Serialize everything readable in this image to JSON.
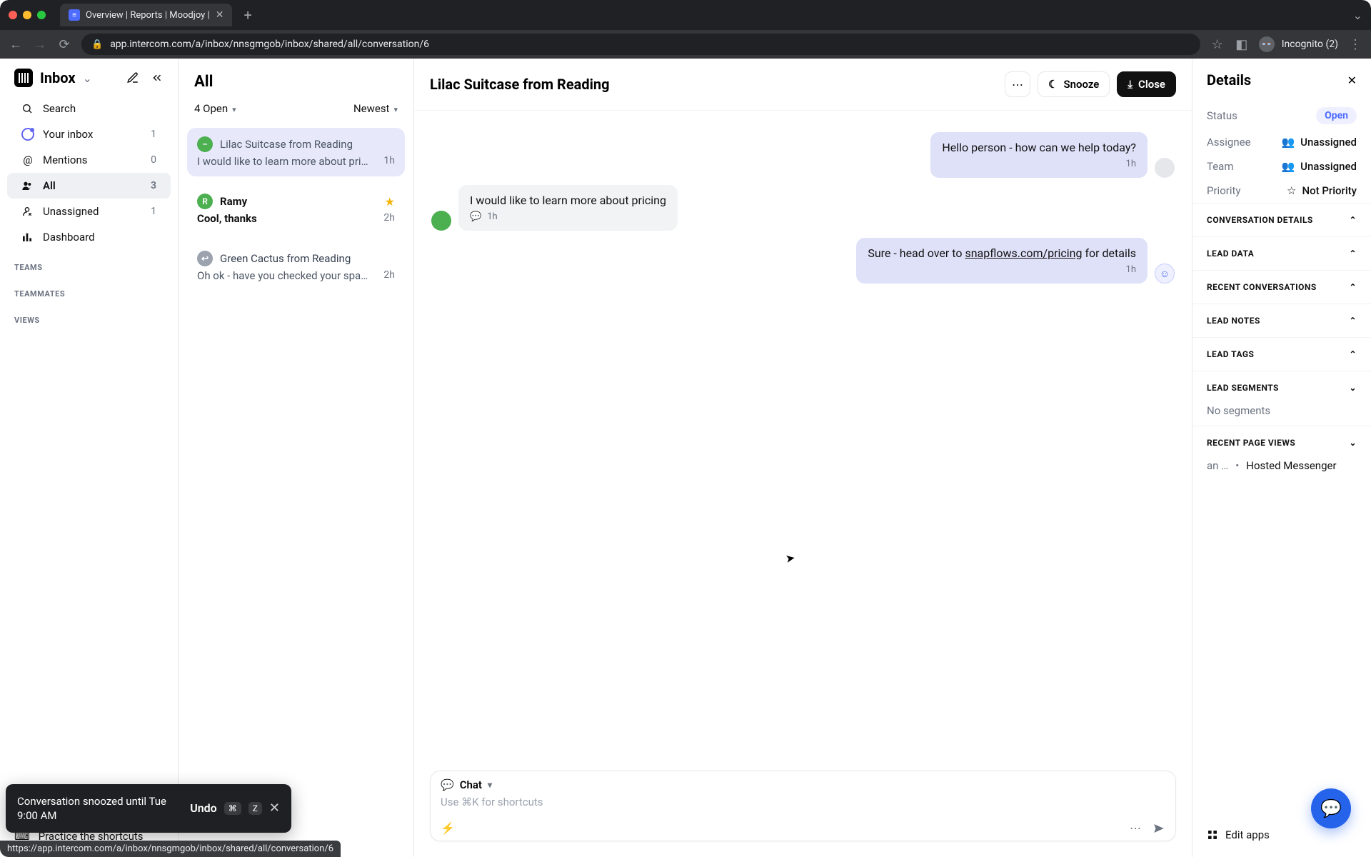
{
  "browser": {
    "tab_title": "Overview | Reports | Moodjoy |",
    "url": "app.intercom.com/a/inbox/nnsgmgob/inbox/shared/all/conversation/6",
    "incognito_label": "Incognito (2)"
  },
  "sidebar": {
    "title": "Inbox",
    "search": "Search",
    "items": [
      {
        "label": "Your inbox",
        "count": "1"
      },
      {
        "label": "Mentions",
        "count": "0"
      },
      {
        "label": "All",
        "count": "3"
      },
      {
        "label": "Unassigned",
        "count": "1"
      },
      {
        "label": "Dashboard",
        "count": ""
      }
    ],
    "sections": {
      "teams": "TEAMS",
      "teammates": "TEAMMATES",
      "views": "VIEWS"
    },
    "shortcuts": "Practice the shortcuts"
  },
  "list": {
    "heading": "All",
    "filter_open": "4 Open",
    "sort": "Newest",
    "items": [
      {
        "name": "Lilac Suitcase from Reading",
        "preview": "I would like to learn more about pricing",
        "time": "1h",
        "avatar": "–",
        "avatar_class": "green",
        "selected": true,
        "starred": false,
        "bold": false,
        "reply": false
      },
      {
        "name": "Ramy",
        "preview": "Cool, thanks",
        "time": "2h",
        "avatar": "R",
        "avatar_class": "green",
        "selected": false,
        "starred": true,
        "bold": true,
        "reply": false
      },
      {
        "name": "Green Cactus from Reading",
        "preview": "Oh ok - have you checked your spam?",
        "time": "2h",
        "avatar": "↩",
        "avatar_class": "grey",
        "selected": false,
        "starred": false,
        "bold": false,
        "reply": true
      }
    ]
  },
  "conversation": {
    "title": "Lilac Suitcase from Reading",
    "actions": {
      "snooze": "Snooze",
      "close": "Close"
    },
    "messages": {
      "m1": {
        "text": "Hello person - how can we help today?",
        "time": "1h"
      },
      "m2": {
        "text": "I would like to learn more about pricing",
        "time": "1h"
      },
      "m3": {
        "prefix": "Sure - head over to ",
        "link": "snapflows.com/pricing",
        "suffix": " for details",
        "time": "1h"
      }
    },
    "composer": {
      "mode": "Chat",
      "placeholder": "Use ⌘K for shortcuts"
    }
  },
  "details": {
    "heading": "Details",
    "status": {
      "k": "Status",
      "v": "Open"
    },
    "assignee": {
      "k": "Assignee",
      "v": "Unassigned"
    },
    "team": {
      "k": "Team",
      "v": "Unassigned"
    },
    "priority": {
      "k": "Priority",
      "v": "Not Priority"
    },
    "sections": {
      "conversation_details": "CONVERSATION DETAILS",
      "lead_data": "LEAD DATA",
      "recent_conversations": "RECENT CONVERSATIONS",
      "lead_notes": "LEAD NOTES",
      "lead_tags": "LEAD TAGS",
      "lead_segments": "LEAD SEGMENTS",
      "no_segments": "No segments",
      "recent_page_views": "RECENT PAGE VIEWS",
      "pv_time": "an …",
      "pv_value": "Hosted Messenger"
    },
    "edit_apps": "Edit apps"
  },
  "toast": {
    "message": "Conversation snoozed until Tue 9:00 AM",
    "undo": "Undo",
    "k1": "⌘",
    "k2": "Z"
  },
  "status_bar": "https://app.intercom.com/a/inbox/nnsgmgob/inbox/shared/all/conversation/6"
}
